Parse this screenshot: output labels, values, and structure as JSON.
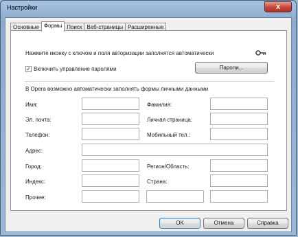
{
  "window": {
    "title": "Настройки",
    "close_glyph": "x"
  },
  "tabs": [
    {
      "label": "Основные",
      "active": false
    },
    {
      "label": "Формы",
      "active": true
    },
    {
      "label": "Поиск",
      "active": false
    },
    {
      "label": "Веб-страницы",
      "active": false
    },
    {
      "label": "Расширенные",
      "active": false
    }
  ],
  "passwords": {
    "hint": "Нажмите иконку с ключом и поля авторизации заполнятся автоматически",
    "key_icon": "key-icon",
    "checkbox_label": "Включить управление паролями",
    "checkbox_checked": true,
    "checkbox_glyph": "✓",
    "button": "Пароли..."
  },
  "forms": {
    "intro": "В Opera возможно автоматически заполнять формы личными данными",
    "name": "Имя:",
    "surname": "Фамилия:",
    "email": "Эл. почта:",
    "homepage": "Личная страница:",
    "phone": "Телефон:",
    "mobile": "Мобильный тел.:",
    "address": "Адрес:",
    "city": "Город:",
    "region": "Регион/Область:",
    "zip": "Индекс:",
    "country": "Страна:",
    "other": "Прочее:"
  },
  "footer": {
    "ok": "OK",
    "cancel": "Отмена",
    "help": "Справка"
  }
}
